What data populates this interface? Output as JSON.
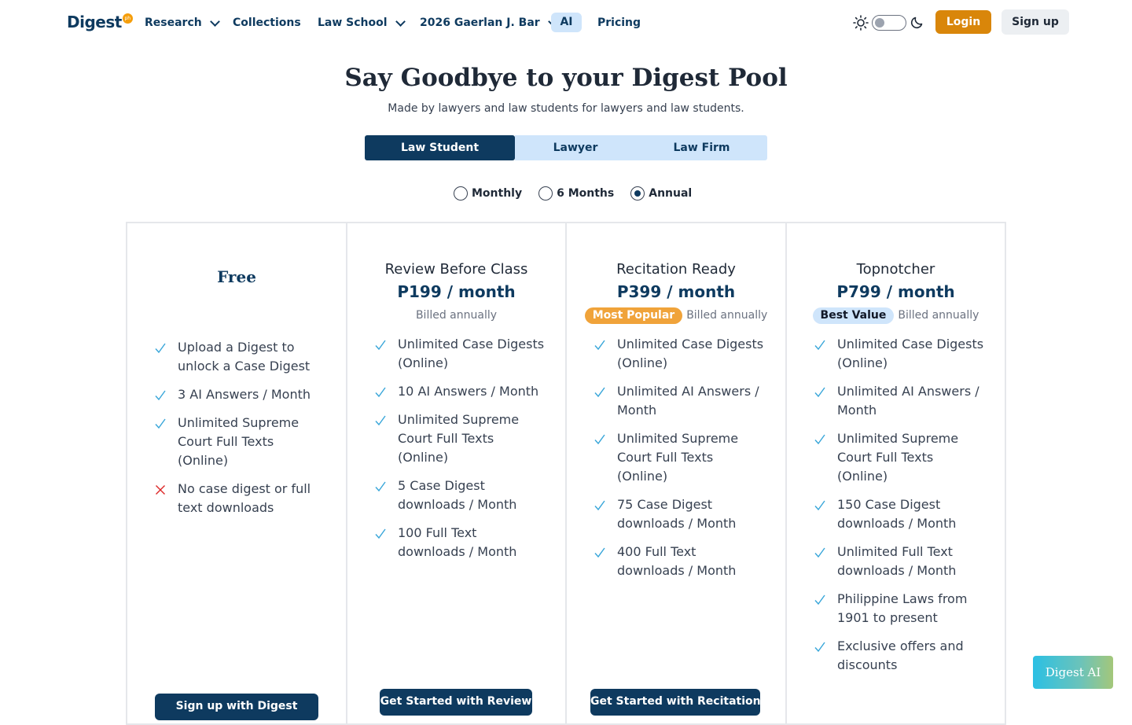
{
  "nav": {
    "logo_text": "Digest",
    "logo_badge": "ph",
    "items": [
      {
        "label": "Research",
        "has_dropdown": true
      },
      {
        "label": "Collections",
        "has_dropdown": false
      },
      {
        "label": "Law School",
        "has_dropdown": true
      },
      {
        "label": "2026 Gaerlan J. Bar",
        "has_dropdown": true
      },
      {
        "label": "AI",
        "has_dropdown": false
      },
      {
        "label": "Pricing",
        "has_dropdown": false
      }
    ],
    "theme_icons": [
      "sun-icon",
      "moon-icon"
    ],
    "login_label": "Login",
    "signup_label": "Sign up"
  },
  "hero": {
    "title": "Say Goodbye to your Digest Pool",
    "subtitle": "Made by lawyers and law students for lawyers and law students."
  },
  "audience_tabs": {
    "items": [
      "Law Student",
      "Lawyer",
      "Law Firm"
    ],
    "selected": "Law Student"
  },
  "billing": {
    "options": [
      "Monthly",
      "6 Months",
      "Annual"
    ],
    "selected": "Annual"
  },
  "plans": [
    {
      "name": "Free",
      "features": [
        {
          "text": "Upload a Digest to unlock a Case Digest",
          "included": true
        },
        {
          "text": "3 AI Answers / Month",
          "included": true
        },
        {
          "text": "Unlimited Supreme Court Full Texts (Online)",
          "included": true
        },
        {
          "text": "No case digest or full text downloads",
          "included": false
        }
      ],
      "cta": "Sign up with Digest"
    },
    {
      "name": "Review Before Class",
      "price": "P199 / month",
      "billing_note": "Billed annually",
      "features": [
        {
          "text": "Unlimited Case Digests (Online)",
          "included": true
        },
        {
          "text": "10 AI Answers / Month",
          "included": true
        },
        {
          "text": "Unlimited Supreme Court Full Texts (Online)",
          "included": true
        },
        {
          "text": "5 Case Digest downloads / Month",
          "included": true
        },
        {
          "text": "100 Full Text downloads / Month",
          "included": true
        }
      ],
      "cta": "Get Started with Review"
    },
    {
      "name": "Recitation Ready",
      "price": "P399 / month",
      "badge": "Most Popular",
      "billing_note": "Billed annually",
      "features": [
        {
          "text": "Unlimited Case Digests (Online)",
          "included": true
        },
        {
          "text": "Unlimited AI Answers / Month",
          "included": true
        },
        {
          "text": "Unlimited Supreme Court Full Texts (Online)",
          "included": true
        },
        {
          "text": "75 Case Digest downloads / Month",
          "included": true
        },
        {
          "text": "400 Full Text downloads / Month",
          "included": true
        }
      ],
      "cta": "Get Started with Recitation"
    },
    {
      "name": "Topnotcher",
      "price": "P799 / month",
      "badge": "Best Value",
      "billing_note": "Billed annually",
      "features": [
        {
          "text": "Unlimited Case Digests (Online)",
          "included": true
        },
        {
          "text": "Unlimited AI Answers / Month",
          "included": true
        },
        {
          "text": "Unlimited Supreme Court Full Texts (Online)",
          "included": true
        },
        {
          "text": "150 Case Digest downloads / Month",
          "included": true
        },
        {
          "text": "Unlimited Full Text downloads / Month",
          "included": true
        },
        {
          "text": "Philippine Laws from 1901 to present",
          "included": true
        },
        {
          "text": "Exclusive offers and discounts",
          "included": true
        }
      ]
    }
  ],
  "floating": {
    "digest_ai_label": "Digest AI"
  },
  "colors": {
    "brand_navy": "#0e3a5f",
    "accent_orange": "#d9860a",
    "popular_badge": "#f0a33a",
    "light_blue": "#cfe5fb",
    "check": "#38a6d9",
    "cross": "#dc2626"
  }
}
